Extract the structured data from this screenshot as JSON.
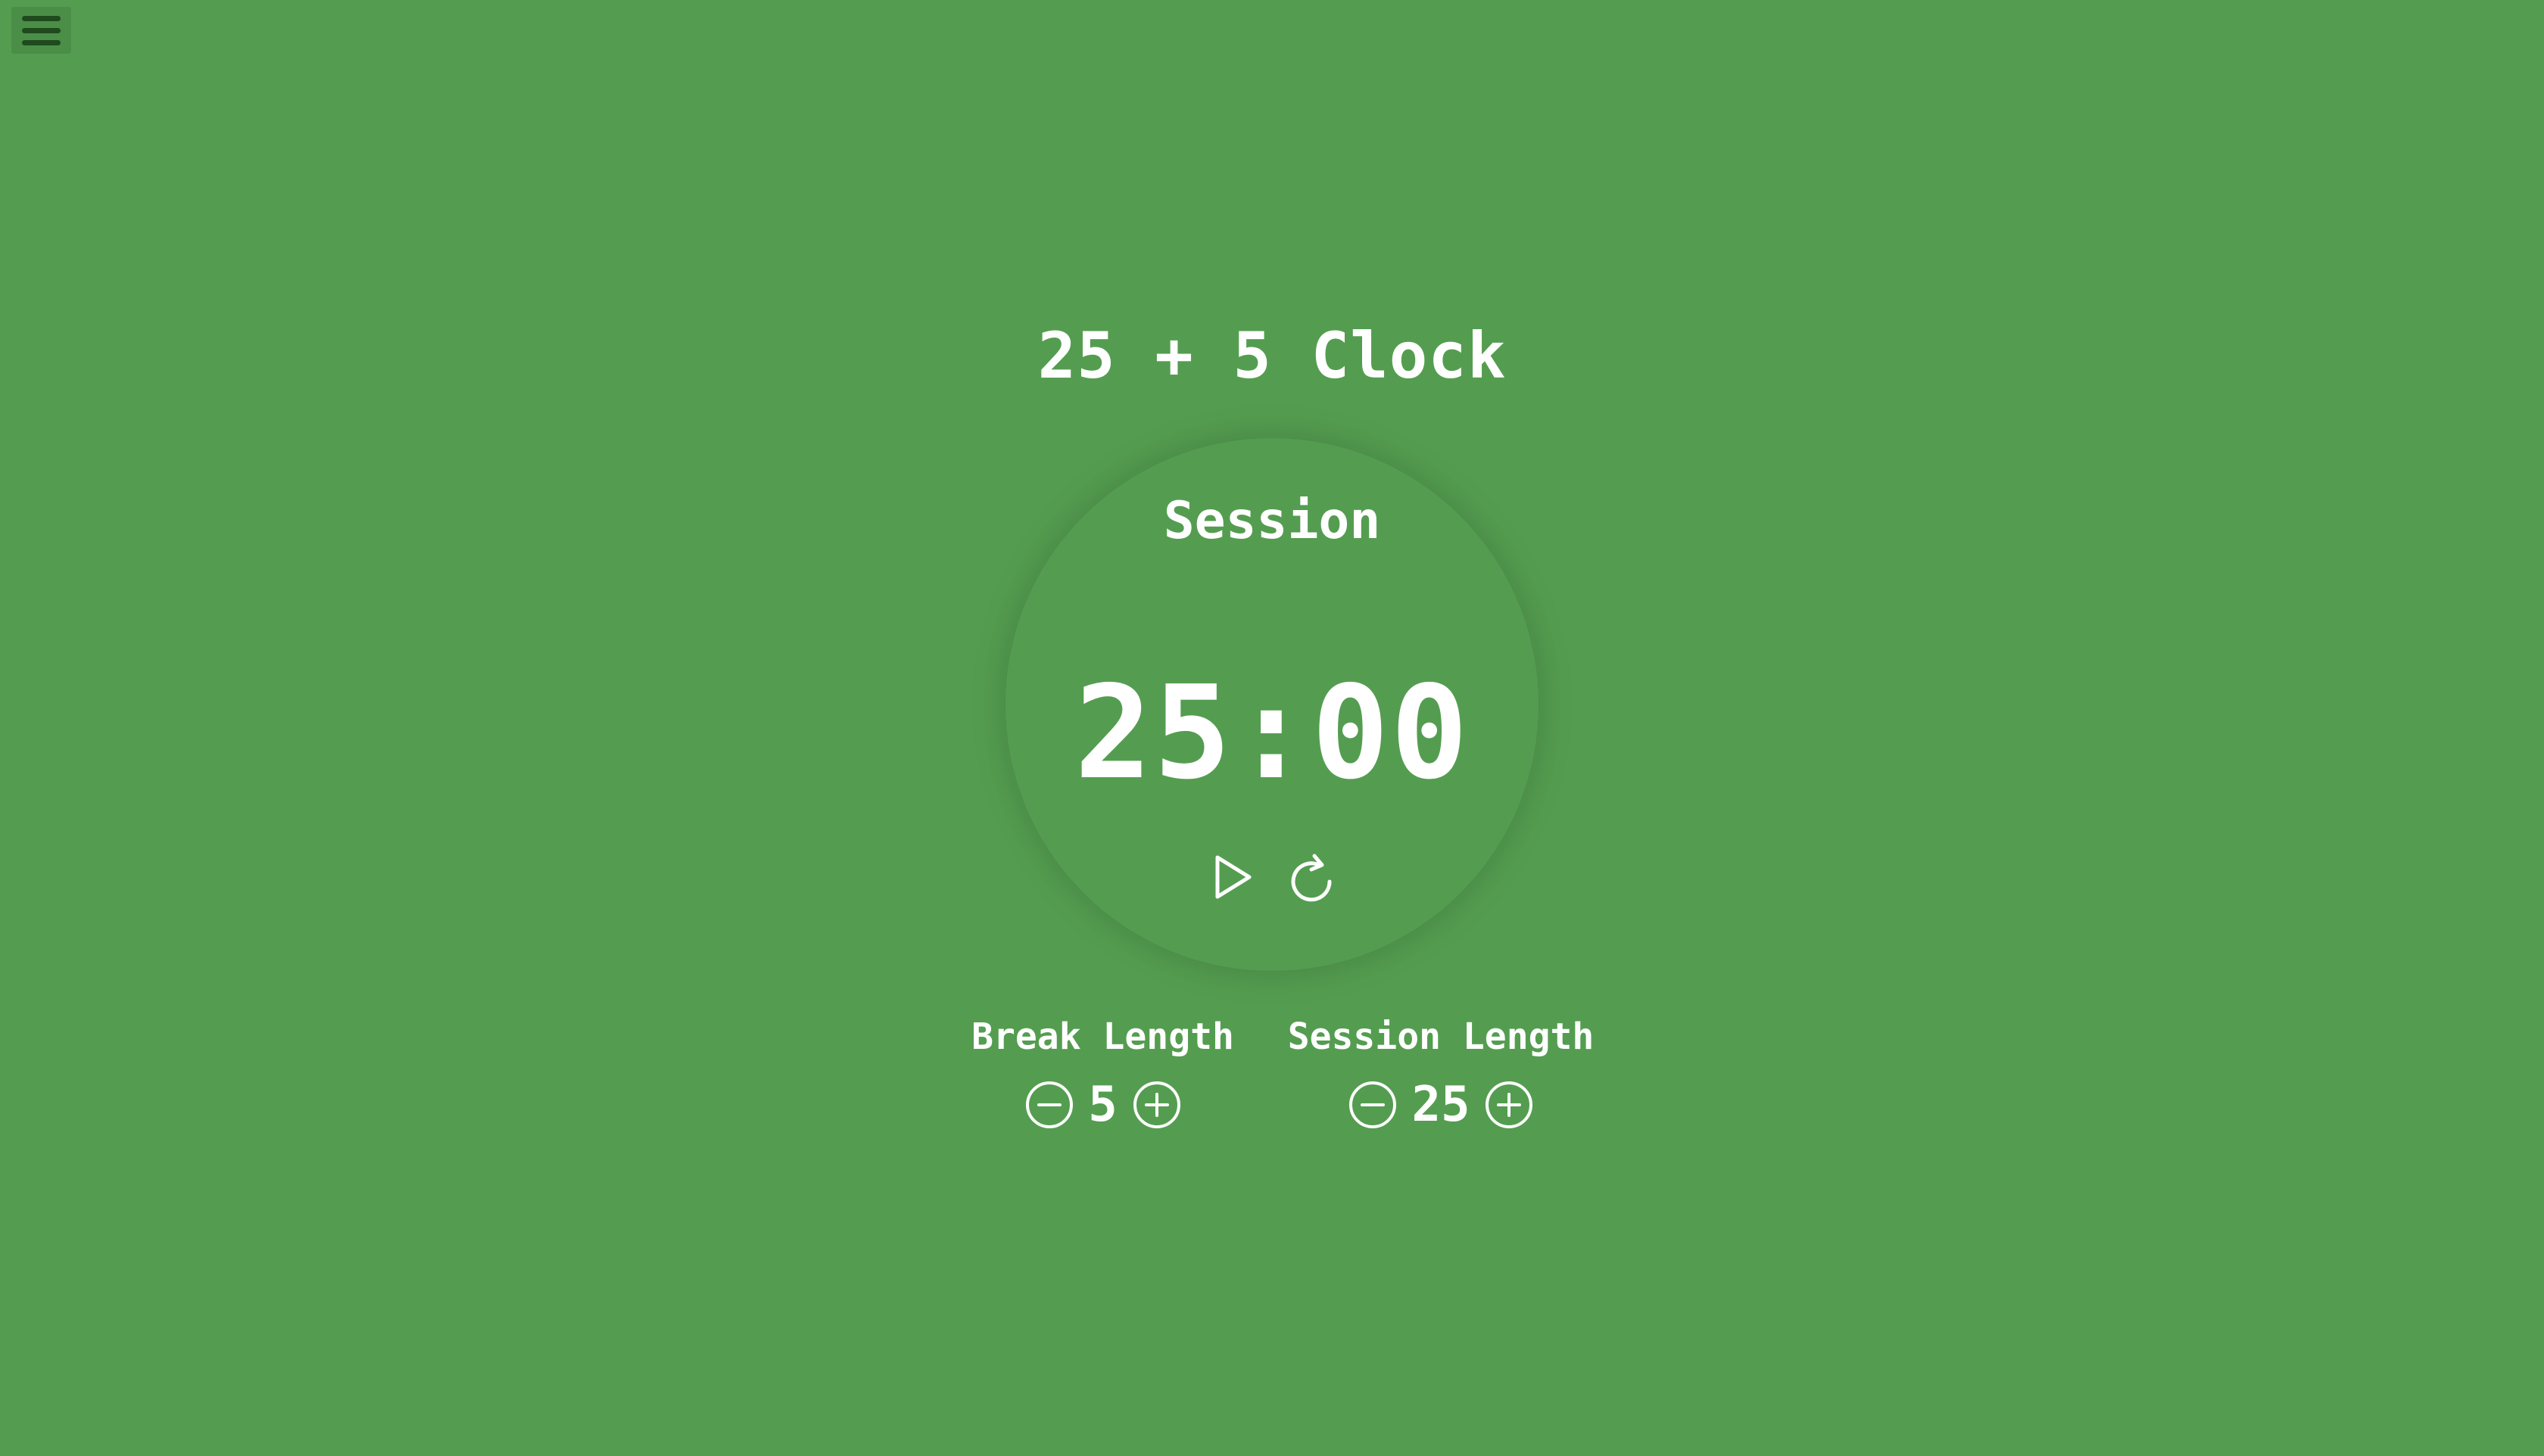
{
  "app": {
    "title": "25 + 5 Clock"
  },
  "menu": {
    "icon": "hamburger-menu-icon"
  },
  "timer": {
    "label": "Session",
    "time_left": "25:00",
    "controls": [
      {
        "name": "start-stop",
        "icon": "play-icon"
      },
      {
        "name": "reset",
        "icon": "refresh-icon"
      }
    ]
  },
  "break_length": {
    "label": "Break Length",
    "value": "5",
    "decrement_icon": "minus-circle-icon",
    "increment_icon": "plus-circle-icon"
  },
  "session_length": {
    "label": "Session Length",
    "value": "25",
    "decrement_icon": "minus-circle-icon",
    "increment_icon": "plus-circle-icon"
  },
  "colors": {
    "background": "#549d50",
    "text": "#ffffff",
    "menu_button_bg": "#4a8e47",
    "menu_bars": "#1f4a1d"
  }
}
